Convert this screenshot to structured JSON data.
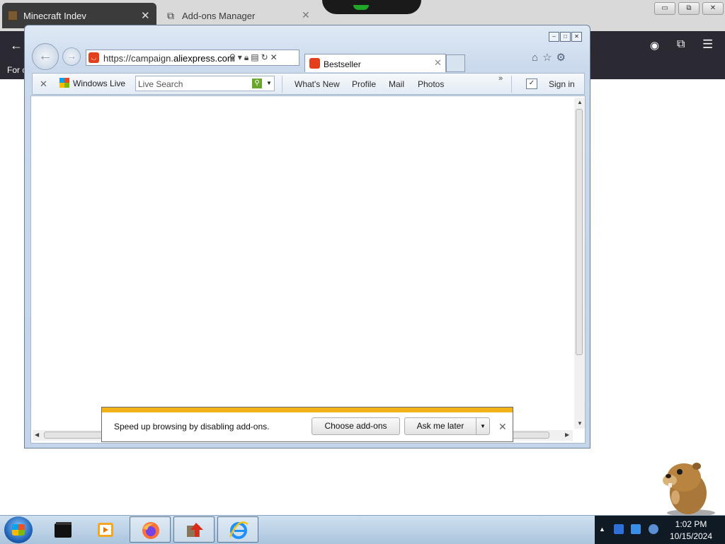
{
  "firefox": {
    "tabs": [
      {
        "title": "Minecraft Indev",
        "active": true
      },
      {
        "title": "Add-ons Manager",
        "active": false
      }
    ],
    "window_buttons": [
      "▭",
      "⧉",
      "✕"
    ],
    "toolbar_partial_text": "For c"
  },
  "ie": {
    "address_prefix": "https://campaign.",
    "address_domain": "aliexpress.com",
    "tab_title": "Bestseller",
    "command_bar": {
      "windows_live_label": "Windows Live",
      "search_placeholder": "Live Search",
      "links": [
        "What's New",
        "Profile",
        "Mail",
        "Photos"
      ],
      "sign_in": "Sign in"
    }
  },
  "notification": {
    "message": "Speed up browsing by disabling add-ons.",
    "choose_label": "Choose add-ons",
    "later_label": "Ask me later"
  },
  "taskbar": {
    "time": "1:02 PM",
    "date": "10/15/2024",
    "apps": [
      "terminal-app",
      "media-player",
      "firefox",
      "game-app",
      "internet-explorer"
    ]
  },
  "colors": {
    "firefox_toolbar": "#2b2a33",
    "notification_accent": "#f2b31a",
    "aliexpress_red": "#e43f1c",
    "tray_bg": "#0f1a24"
  }
}
